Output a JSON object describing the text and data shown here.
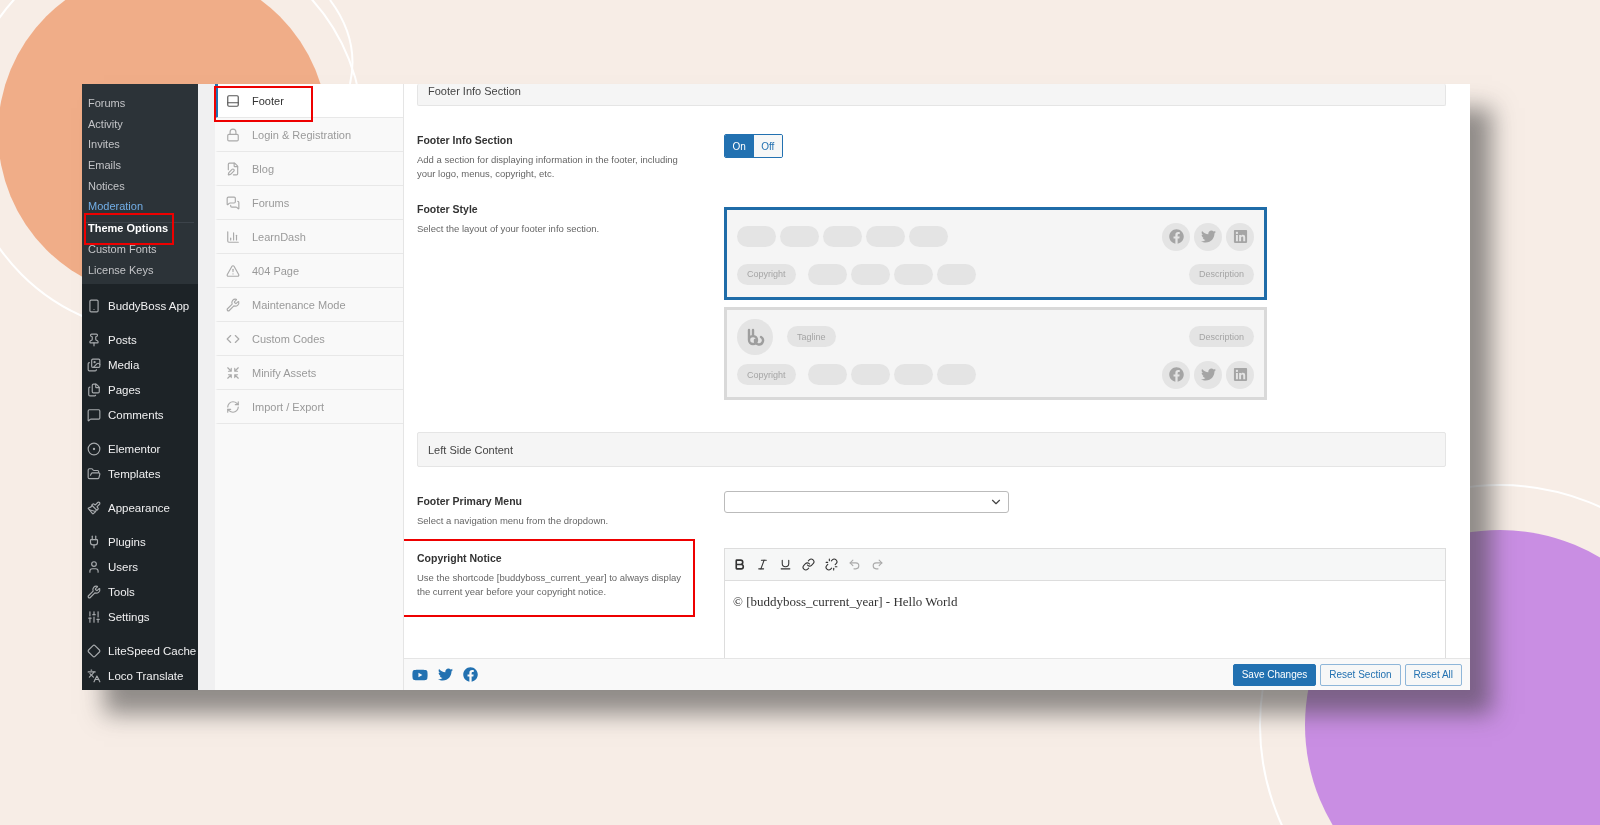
{
  "admin_menu": {
    "submenu": [
      {
        "label": "Forums",
        "selected": false,
        "highlighted": false,
        "annotated": false
      },
      {
        "label": "Activity",
        "selected": false,
        "highlighted": false,
        "annotated": false
      },
      {
        "label": "Invites",
        "selected": false,
        "highlighted": false,
        "annotated": false
      },
      {
        "label": "Emails",
        "selected": false,
        "highlighted": false,
        "annotated": false
      },
      {
        "label": "Notices",
        "selected": false,
        "highlighted": false,
        "annotated": false
      },
      {
        "label": "Moderation",
        "selected": false,
        "highlighted": true,
        "annotated": false
      },
      {
        "label": "Theme Options",
        "selected": true,
        "highlighted": false,
        "annotated": true
      },
      {
        "label": "Custom Fonts",
        "selected": false,
        "highlighted": false,
        "annotated": false
      },
      {
        "label": "License Keys",
        "selected": false,
        "highlighted": false,
        "annotated": false
      }
    ],
    "groups": [
      [
        {
          "label": "BuddyBoss App"
        }
      ],
      [
        {
          "label": "Posts"
        },
        {
          "label": "Media"
        },
        {
          "label": "Pages"
        },
        {
          "label": "Comments"
        }
      ],
      [
        {
          "label": "Elementor"
        },
        {
          "label": "Templates"
        }
      ],
      [
        {
          "label": "Appearance"
        }
      ],
      [
        {
          "label": "Plugins"
        },
        {
          "label": "Users"
        },
        {
          "label": "Tools"
        },
        {
          "label": "Settings"
        }
      ],
      [
        {
          "label": "LiteSpeed Cache"
        },
        {
          "label": "Loco Translate"
        }
      ]
    ]
  },
  "theme_sections": [
    {
      "label": "Footer",
      "selected": true,
      "annotated": true
    },
    {
      "label": "Login & Registration",
      "selected": false,
      "annotated": false
    },
    {
      "label": "Blog",
      "selected": false,
      "annotated": false
    },
    {
      "label": "Forums",
      "selected": false,
      "annotated": false
    },
    {
      "label": "LearnDash",
      "selected": false,
      "annotated": false
    },
    {
      "label": "404 Page",
      "selected": false,
      "annotated": false
    },
    {
      "label": "Maintenance Mode",
      "selected": false,
      "annotated": false
    },
    {
      "label": "Custom Codes",
      "selected": false,
      "annotated": false
    },
    {
      "label": "Minify Assets",
      "selected": false,
      "annotated": false
    },
    {
      "label": "Import / Export",
      "selected": false,
      "annotated": false
    }
  ],
  "content": {
    "section_header": "Footer Info Section",
    "footer_info": {
      "label": "Footer Info Section",
      "description": "Add a section for displaying information in the footer, including your logo, menus, copyright, etc.",
      "toggle": {
        "on_label": "On",
        "off_label": "Off",
        "on": true
      }
    },
    "footer_style": {
      "label": "Footer Style",
      "description": "Select the layout of your footer info section.",
      "options": [
        {
          "kind": "menu-top",
          "selected": true,
          "copyright": "Copyright",
          "description": "Description"
        },
        {
          "kind": "logo-top",
          "selected": false,
          "tagline": "Tagline",
          "description": "Description",
          "copyright": "Copyright"
        }
      ]
    },
    "left_side_header": "Left Side Content",
    "primary_menu": {
      "label": "Footer Primary Menu",
      "description": "Select a navigation menu from the dropdown."
    },
    "copyright_notice": {
      "label": "Copyright Notice",
      "description": "Use the shortcode [buddyboss_current_year] to always display the current year before your copyright notice.",
      "annotated": true,
      "value": "© [buddyboss_current_year] - Hello World"
    }
  },
  "footer_bar": {
    "buttons": [
      {
        "label": "Save Changes",
        "kind": "primary"
      },
      {
        "label": "Reset Section",
        "kind": "secondary"
      },
      {
        "label": "Reset All",
        "kind": "secondary"
      }
    ]
  }
}
